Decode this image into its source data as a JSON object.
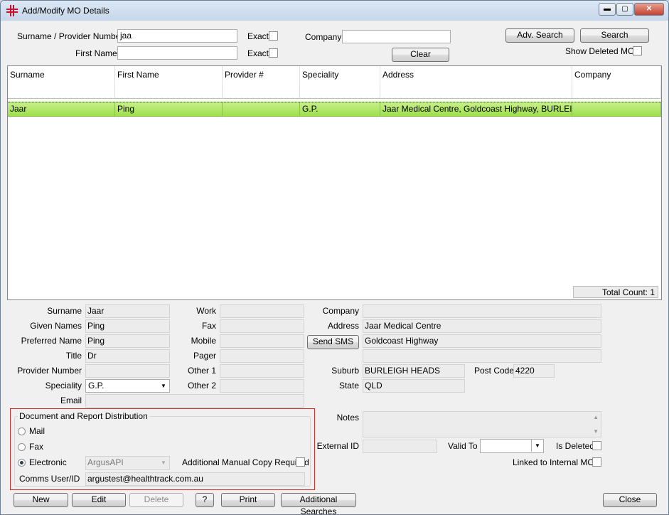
{
  "window": {
    "title": "Add/Modify MO Details",
    "minimize": "▬",
    "maximize": "▢",
    "close": "✕"
  },
  "search": {
    "surname_label": "Surname / Provider Number",
    "surname_value": "jaa",
    "firstname_label": "First Name",
    "firstname_value": "",
    "exact_label": "Exact",
    "company_label": "Company",
    "company_value": "",
    "adv_search": "Adv. Search",
    "search": "Search",
    "clear": "Clear",
    "show_deleted": "Show Deleted MOs"
  },
  "grid": {
    "columns": [
      "Surname",
      "First Name",
      "Provider #",
      "Speciality",
      "Address",
      "Company"
    ],
    "rows": [
      [
        "Jaar",
        "Ping",
        "",
        "G.P.",
        "Jaar Medical Centre, Goldcoast Highway, BURLEIGH...",
        ""
      ]
    ],
    "total_count": "Total Count: 1"
  },
  "details": {
    "surname_label": "Surname",
    "surname": "Jaar",
    "given_label": "Given Names",
    "given": "Ping",
    "preferred_label": "Preferred Name",
    "preferred": "Ping",
    "title_label": "Title",
    "title": "Dr",
    "provider_label": "Provider Number",
    "provider": "",
    "speciality_label": "Speciality",
    "speciality": "G.P.",
    "email_label": "Email",
    "email": "",
    "work_label": "Work",
    "fax_label": "Fax",
    "mobile_label": "Mobile",
    "pager_label": "Pager",
    "other1_label": "Other 1",
    "other2_label": "Other 2",
    "send_sms": "Send SMS",
    "company_label": "Company",
    "company": "",
    "address_label": "Address",
    "address1": "Jaar Medical Centre",
    "address2": "Goldcoast Highway",
    "address3": "",
    "suburb_label": "Suburb",
    "suburb": "BURLEIGH HEADS",
    "postcode_label": "Post Code",
    "postcode": "4220",
    "state_label": "State",
    "state": "QLD",
    "notes_label": "Notes",
    "external_id_label": "External ID",
    "valid_to_label": "Valid To",
    "is_deleted_label": "Is Deleted",
    "linked_label": "Linked to Internal MO"
  },
  "distribution": {
    "legend": "Document and Report Distribution",
    "mail": "Mail",
    "fax": "Fax",
    "electronic": "Electronic",
    "selected": "Electronic",
    "electronic_type": "ArgusAPI",
    "manual_copy": "Additional Manual Copy Required",
    "comms_label": "Comms User/ID",
    "comms_value": "argustest@healthtrack.com.au"
  },
  "buttons": {
    "new": "New",
    "edit": "Edit",
    "delete": "Delete",
    "help": "?",
    "print": "Print",
    "additional": "Additional Searches",
    "close": "Close"
  },
  "colors": {
    "selected_row": "#a9e65a",
    "highlight_box": "#d22a2a",
    "app_icon": "#c8102e"
  }
}
